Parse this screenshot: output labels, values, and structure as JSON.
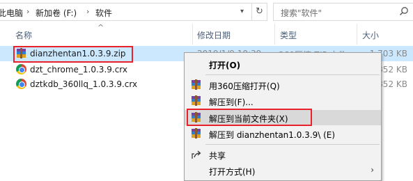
{
  "address": {
    "crumbs": [
      "此电脑",
      "新加卷 (F:)",
      "软件"
    ],
    "separator": "›"
  },
  "search": {
    "placeholder": "搜索\"软件\""
  },
  "columns": {
    "name": "名称",
    "date": "修改日期",
    "type": "类型",
    "size": "大小"
  },
  "files": [
    {
      "name": "dianzhentan1.0.3.9.zip",
      "date": "2019/1/9 10:39",
      "type": "360压缩 ZIP 文件",
      "size": "1,703 KB",
      "icon": "archive-icon",
      "selected": true
    },
    {
      "name": "dzt_chrome_1.0.3.9.crx",
      "date": "",
      "type": "",
      "size": "852 KB",
      "icon": "chrome-icon",
      "selected": false
    },
    {
      "name": "dztkdb_360llq_1.0.3.9.crx",
      "date": "",
      "type": "",
      "size": "852 KB",
      "icon": "chrome-icon",
      "selected": false
    }
  ],
  "context_menu": {
    "open": "打开(O)",
    "open_360": "用360压缩打开(Q)",
    "extract_to": "解压到(F)...",
    "extract_here": "解压到当前文件夹(X)",
    "extract_folder": "解压到 dianzhentan1.0.3.9\\ (E)",
    "share": "共享",
    "open_with": "打开方式(H)"
  },
  "colors": {
    "highlight": "#e8212b",
    "selection": "#cce8ff",
    "menu_bg": "#f2f2f2"
  }
}
